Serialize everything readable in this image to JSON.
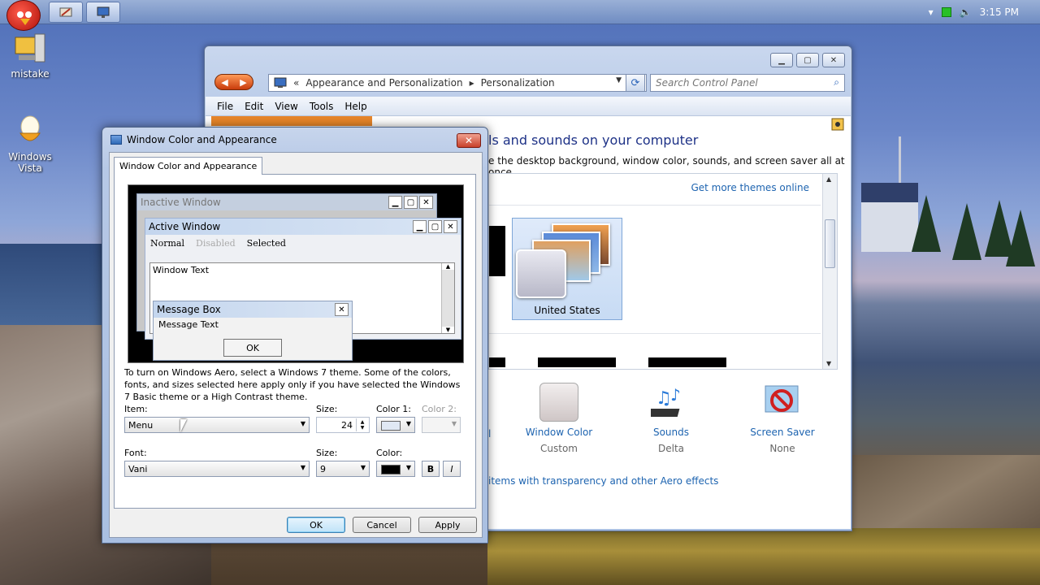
{
  "taskbar": {
    "clock": "3:15 PM",
    "tray_icons": [
      "chevron-up-icon",
      "network-icon",
      "volume-icon"
    ]
  },
  "desktop": {
    "icons": [
      {
        "label": "mistake"
      },
      {
        "label": "Windows Vista"
      }
    ]
  },
  "control_panel": {
    "breadcrumb": [
      "Appearance and Personalization",
      "Personalization"
    ],
    "search_placeholder": "Search Control Panel",
    "menu": [
      "File",
      "Edit",
      "View",
      "Tools",
      "Help"
    ],
    "heading": "ls and sounds on your computer",
    "subheading": "e the desktop background, window color, sounds, and screen saver all at once.",
    "more_themes_link": "Get more themes online",
    "selected_theme": "United States",
    "items": [
      {
        "title": "Window Color",
        "sub": "Custom"
      },
      {
        "title": "Sounds",
        "sub": "Delta"
      },
      {
        "title": "Screen Saver",
        "sub": "None"
      }
    ],
    "partial_link": "l",
    "aero_link": "items with transparency and other Aero effects"
  },
  "dialog": {
    "title": "Window Color and Appearance",
    "tab": "Window Color and Appearance",
    "preview": {
      "inactive_title": "Inactive Window",
      "active_title": "Active Window",
      "menu_normal": "Normal",
      "menu_disabled": "Disabled",
      "menu_selected": "Selected",
      "window_text": "Window Text",
      "msgbox_title": "Message Box",
      "msgbox_text": "Message Text",
      "msgbox_ok": "OK"
    },
    "explanation": "To turn on Windows Aero, select a Windows 7 theme.  Some of the colors, fonts, and sizes selected here apply only if you have selected the Windows 7 Basic theme or a High Contrast theme.",
    "item_label": "Item:",
    "item_value": "Menu",
    "size_label": "Size:",
    "size_value": "24",
    "color1_label": "Color 1:",
    "color2_label": "Color 2:",
    "font_label": "Font:",
    "font_value": "Vani",
    "font_size_label": "Size:",
    "font_size_value": "9",
    "color_label": "Color:",
    "bold_label": "B",
    "italic_label": "I",
    "ok": "OK",
    "cancel": "Cancel",
    "apply": "Apply",
    "colors": {
      "color1": "#e0e8f4",
      "font_color": "#000000"
    }
  }
}
